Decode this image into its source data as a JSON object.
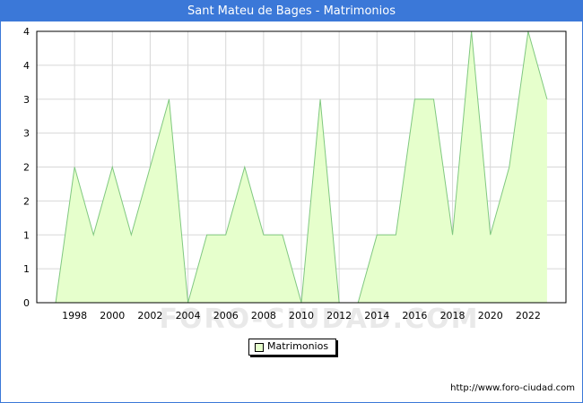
{
  "title": "Sant Mateu de Bages - Matrimonios",
  "source_url": "http://www.foro-ciudad.com",
  "watermark": "FORO-CIUDAD.COM",
  "colors": {
    "title_bar": "#3b78d8",
    "area_fill": "#e6ffcc",
    "line": "#80c880",
    "grid": "#d8d8d8"
  },
  "chart_data": {
    "type": "area",
    "title": "Sant Mateu de Bages - Matrimonios",
    "x": [
      1997,
      1998,
      1999,
      2000,
      2001,
      2002,
      2003,
      2004,
      2005,
      2006,
      2007,
      2008,
      2009,
      2010,
      2011,
      2012,
      2013,
      2014,
      2015,
      2016,
      2017,
      2018,
      2019,
      2020,
      2021,
      2022,
      2023
    ],
    "series": [
      {
        "name": "Matrimonios",
        "values": [
          0,
          2,
          1,
          2,
          1,
          2,
          3,
          0,
          1,
          1,
          2,
          1,
          1,
          0,
          3,
          0,
          0,
          1,
          1,
          3,
          3,
          1,
          4,
          1,
          2,
          4,
          3
        ]
      }
    ],
    "xticks": [
      "1998",
      "2000",
      "2002",
      "2004",
      "2006",
      "2008",
      "2010",
      "2012",
      "2014",
      "2016",
      "2018",
      "2020",
      "2022"
    ],
    "yticks": [
      "0",
      "1",
      "1",
      "2",
      "2",
      "3",
      "3",
      "4",
      "4"
    ],
    "ylim": [
      0,
      4
    ],
    "grid": true,
    "legend": "bottom-center"
  }
}
